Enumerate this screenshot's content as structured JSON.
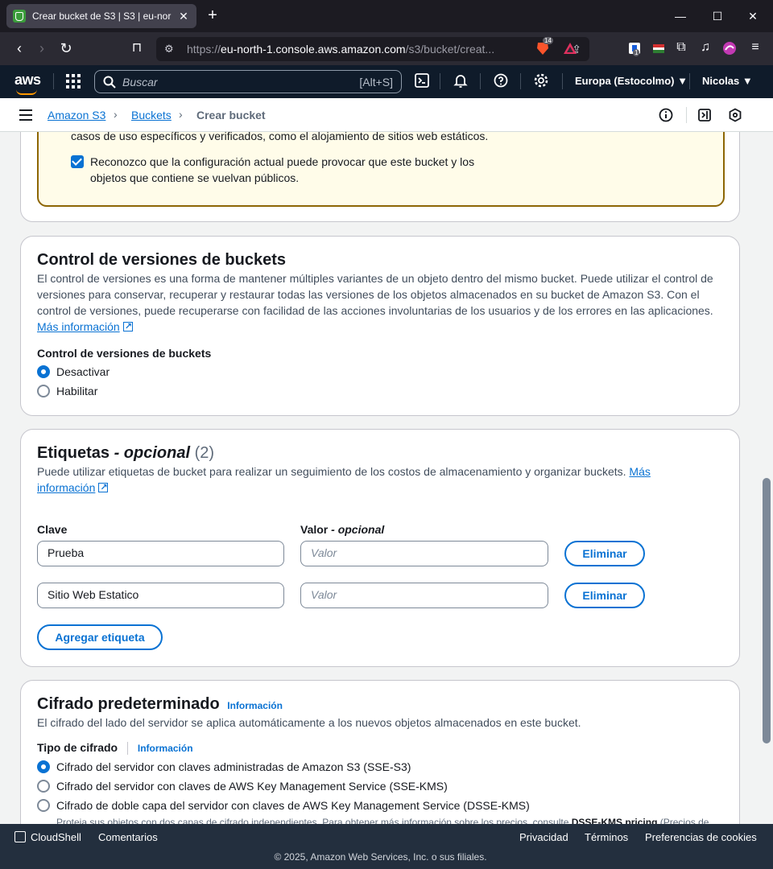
{
  "browser": {
    "tab_title": "Crear bucket de S3 | S3 | eu-nor",
    "tab_close": "✕",
    "new_tab": "+",
    "url_prefix": "https://",
    "url_host": "eu-north-1.console.aws.amazon.com",
    "url_path": "/s3/bucket/creat...",
    "brave_badge": "14",
    "ext_badge": "1"
  },
  "aws_header": {
    "logo": "aws",
    "search_placeholder": "Buscar",
    "search_shortcut": "[Alt+S]",
    "region": "Europa (Estocolmo) ▼",
    "user": "Nicolas ▼"
  },
  "breadcrumb": {
    "items": [
      "Amazon S3",
      "Buckets",
      "Crear bucket"
    ],
    "separator": "›"
  },
  "public_access_warning": {
    "text": "casos de uso específicos y verificados, como el alojamiento de sitios web estáticos.",
    "ack_label": "Reconozco que la configuración actual puede provocar que este bucket y los objetos que contiene se vuelvan públicos.",
    "ack_checked": true
  },
  "versioning": {
    "title": "Control de versiones de buckets",
    "description": "El control de versiones es una forma de mantener múltiples variantes de un objeto dentro del mismo bucket. Puede utilizar el control de versiones para conservar, recuperar y restaurar todas las versiones de los objetos almacenados en su bucket de Amazon S3. Con el control de versiones, puede recuperarse con facilidad de las acciones involuntarias de los usuarios y de los errores en las aplicaciones.",
    "more_info": "Más información",
    "field_label": "Control de versiones de buckets",
    "options": [
      "Desactivar",
      "Habilitar"
    ],
    "selected": "Desactivar"
  },
  "tags": {
    "title": "Etiquetas",
    "title_optional": "- opcional",
    "count": "(2)",
    "description": "Puede utilizar etiquetas de bucket para realizar un seguimiento de los costos de almacenamiento y organizar buckets.",
    "more_info_1": "Más",
    "more_info_2": "información",
    "key_label": "Clave",
    "value_label": "Valor",
    "value_optional": "- opcional",
    "rows": [
      {
        "key": "Prueba",
        "value_placeholder": "Valor",
        "remove": "Eliminar"
      },
      {
        "key": "Sitio Web Estatico",
        "value_placeholder": "Valor",
        "remove": "Eliminar"
      }
    ],
    "add_button": "Agregar etiqueta"
  },
  "encryption": {
    "title": "Cifrado predeterminado",
    "info": "Información",
    "description": "El cifrado del lado del servidor se aplica automáticamente a los nuevos objetos almacenados en este bucket.",
    "type_label": "Tipo de cifrado",
    "type_info": "Información",
    "options": [
      "Cifrado del servidor con claves administradas de Amazon S3 (SSE-S3)",
      "Cifrado del servidor con claves de AWS Key Management Service (SSE-KMS)",
      "Cifrado de doble capa del servidor con claves de AWS Key Management Service (DSSE-KMS)"
    ],
    "selected": "Cifrado del servidor con claves administradas de Amazon S3 (SSE-S3)",
    "dsse_note": "Proteja sus objetos con dos capas de cifrado independientes. Para obtener más información sobre los precios, consulte",
    "dsse_note_bold": "DSSE-KMS pricing",
    "dsse_note_tail": "(Precios de"
  },
  "footer": {
    "cloudshell": "CloudShell",
    "feedback": "Comentarios",
    "privacy": "Privacidad",
    "terms": "Términos",
    "cookies": "Preferencias de cookies",
    "copyright": "© 2025, Amazon Web Services, Inc. o sus filiales."
  }
}
